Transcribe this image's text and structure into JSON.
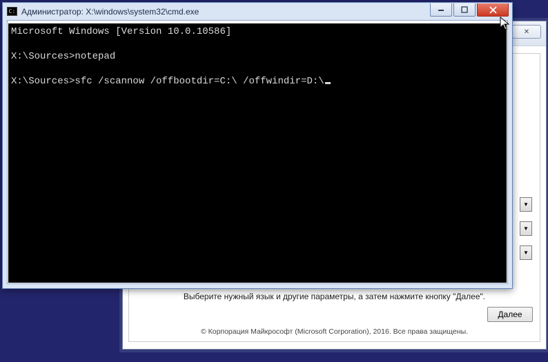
{
  "setup": {
    "instruction": "Выберите нужный язык и другие параметры, а затем нажмите кнопку \"Далее\".",
    "next_label": "Далее",
    "copyright": "© Корпорация Майкрософт (Microsoft Corporation), 2016. Все права защищены.",
    "close_glyph": "✕"
  },
  "cmd": {
    "title": "Администратор: X:\\windows\\system32\\cmd.exe",
    "lines": {
      "l1": "Microsoft Windows [Version 10.0.10586]",
      "l2": "",
      "l3": "X:\\Sources>notepad",
      "l4": "",
      "l5": "X:\\Sources>sfc /scannow /offbootdir=C:\\ /offwindir=D:\\"
    }
  }
}
